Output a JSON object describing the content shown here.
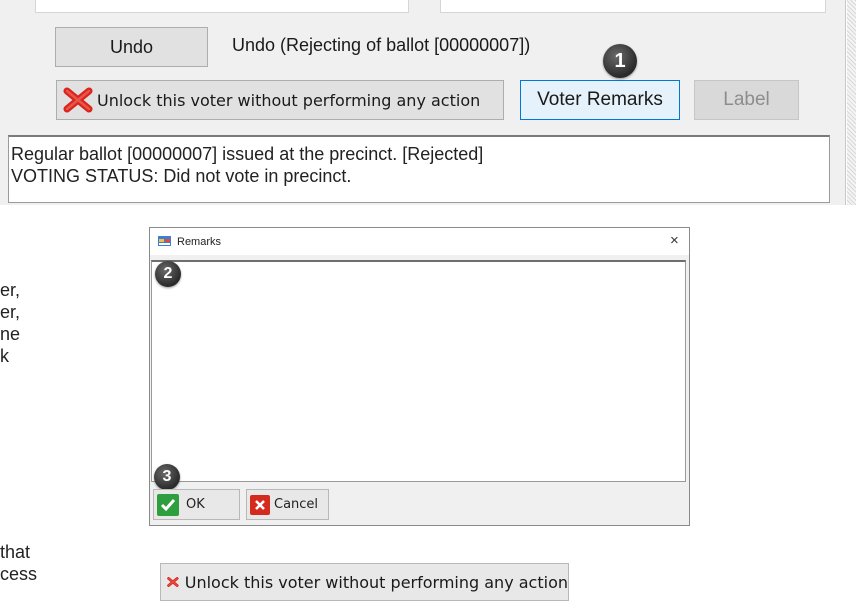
{
  "top_panel": {
    "undo_button": "Undo",
    "undo_description": "Undo (Rejecting of  ballot [00000007])",
    "unlock_button": "Unlock this voter without performing any action",
    "voter_remarks_button": "Voter Remarks",
    "label_button": "Label",
    "status_lines": [
      "Regular ballot [00000007] issued at the precinct. [Rejected]",
      "VOTING STATUS: Did not vote in precinct."
    ]
  },
  "callouts": [
    "1",
    "2",
    "3"
  ],
  "side_text": {
    "line_1": [
      "er,",
      "er,",
      "ne",
      "k"
    ],
    "line_2": [
      "that",
      "cess"
    ]
  },
  "remarks_dialog": {
    "title": "Remarks",
    "close_glyph": "×",
    "remarks_value": "",
    "ok_button": "OK",
    "cancel_button": "Cancel"
  },
  "bottom_unlock_button": "Unlock this voter without performing any action",
  "colors": {
    "panel_bg": "#f0f0f0",
    "remarks_button_border": "#0078d7",
    "ok_green": "#2f9e3e",
    "cancel_red": "#d42b1e",
    "unlock_icon_red": "#d9251c"
  },
  "icons": {
    "unlock": "red-x-icon",
    "title": "form-icon",
    "ok": "checkmark-icon",
    "cancel": "cancel-icon"
  }
}
